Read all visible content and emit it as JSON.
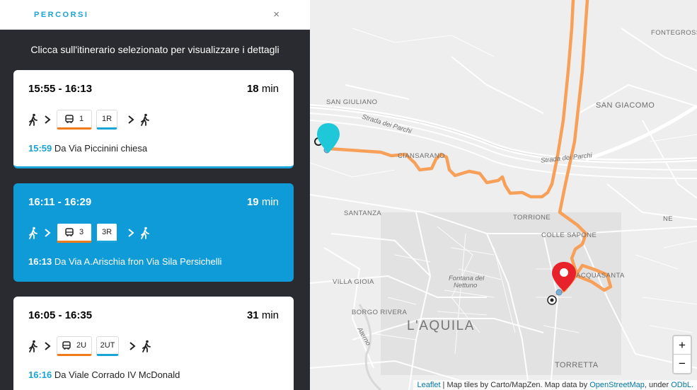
{
  "sidebar": {
    "title": "PERCORSI",
    "close": "×",
    "instruction": "Clicca sull'itinerario selezionato per visualizzare i dettagli"
  },
  "itineraries": [
    {
      "time": "15:55 - 16:13",
      "duration": "18",
      "unit": "min",
      "bus": "1",
      "code": "1R",
      "dep_time": "15:59",
      "dep_text": "Da Via Piccinini chiesa"
    },
    {
      "time": "16:11 - 16:29",
      "duration": "19",
      "unit": "min",
      "bus": "3",
      "code": "3R",
      "dep_time": "16:13",
      "dep_text": "Da Via A.Arischia fron Via Sila Persichelli"
    },
    {
      "time": "16:05 - 16:35",
      "duration": "31",
      "unit": "min",
      "bus": "2U",
      "code": "2UT",
      "dep_time": "16:16",
      "dep_text": "Da Viale Corrado IV McDonald"
    }
  ],
  "map": {
    "labels": {
      "fontegrossa": "FONTEGROSSA",
      "san_giuliano": "SAN GIULIANO",
      "san_giacomo": "SAN GIACOMO",
      "strada_parchi_1": "Strada dei Parchi",
      "strada_parchi_2": "Strada dei Parchi",
      "cansatessa": "CIANSARANO",
      "santanza": "SANTANZA",
      "torrione": "TORRIONE",
      "colle_sapone": "COLLE SAPONE",
      "ne": "NE",
      "acquasanta": "ACQUASANTA",
      "villa_gioia": "VILLA GIOIA",
      "fontana_1": "Fontana del",
      "fontana_2": "Nettuno",
      "borgo_rivera": "BORGO RIVERA",
      "aterno": "Aterno",
      "laquila": "L'AQUILA",
      "torretta": "TORRETTA"
    },
    "zoom_in": "+",
    "zoom_out": "−",
    "attribution": {
      "leaflet": "Leaflet",
      "text1": " | Map tiles by Carto/MapZen. Map data by ",
      "osm": "OpenStreetMap",
      "text2": ", under ",
      "odbl": "ODbL."
    },
    "colors": {
      "route": "#f7a05a",
      "origin_marker": "#1fc8d8",
      "destination_marker": "#e8222a"
    }
  }
}
